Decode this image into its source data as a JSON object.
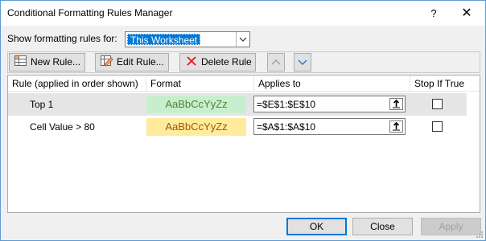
{
  "window": {
    "title": "Conditional Formatting Rules Manager",
    "help_label": "?",
    "close_label": "✕"
  },
  "scope": {
    "label": "Show formatting rules for:",
    "selected": "This Worksheet"
  },
  "toolbar": {
    "new_rule": "New Rule...",
    "edit_rule": "Edit Rule...",
    "delete_rule": "Delete Rule"
  },
  "columns": {
    "rule": "Rule (applied in order shown)",
    "format": "Format",
    "applies_to": "Applies to",
    "stop_if_true": "Stop If True"
  },
  "rules": [
    {
      "rule": "Top 1",
      "format_preview": "AaBbCcYyZz",
      "format_text_color": "#548235",
      "format_fill_color": "#c6efce",
      "applies_to": "=$E$1:$E$10",
      "stop_if_true": false,
      "selected": true
    },
    {
      "rule": "Cell Value > 80",
      "format_preview": "AaBbCcYyZz",
      "format_text_color": "#9c5700",
      "format_fill_color": "#ffeb9c",
      "applies_to": "=$A$1:$A$10",
      "stop_if_true": false,
      "selected": false
    }
  ],
  "buttons": {
    "ok": "OK",
    "close": "Close",
    "apply": "Apply"
  },
  "colors": {
    "accent": "#0078d7",
    "delete_icon": "#e81123",
    "dialog_border": "#5b9bd5"
  }
}
